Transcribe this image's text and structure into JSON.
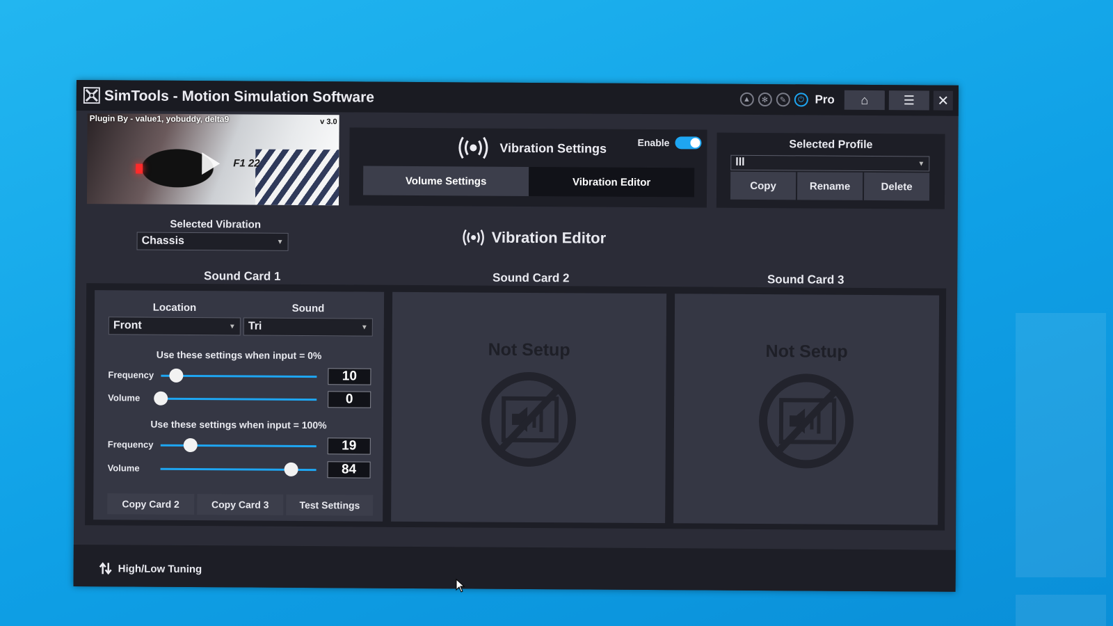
{
  "app": {
    "title": "SimTools - Motion Simulation Software"
  },
  "titlebar": {
    "pro_label": "Pro"
  },
  "banner": {
    "credit": "Plugin By - value1, yobuddy, delta9",
    "version": "v 3.0",
    "game": "F1 22"
  },
  "vibration_settings": {
    "title": "Vibration Settings",
    "enable_label": "Enable",
    "enabled": true,
    "tabs": [
      {
        "label": "Volume Settings",
        "active": true
      },
      {
        "label": "Vibration Editor",
        "active": false
      }
    ]
  },
  "profile": {
    "label": "Selected Profile",
    "value": "lll",
    "buttons": {
      "copy": "Copy",
      "rename": "Rename",
      "delete": "Delete"
    }
  },
  "selected_vibration": {
    "label": "Selected Vibration",
    "value": "Chassis"
  },
  "editor": {
    "title": "Vibration Editor"
  },
  "cards": {
    "c1": {
      "title": "Sound Card 1",
      "location_label": "Location",
      "location_value": "Front",
      "sound_label": "Sound",
      "sound_value": "Tri",
      "low_label": "Use these settings when input = 0%",
      "high_label": "Use these settings when input = 100%",
      "frequency_label": "Frequency",
      "volume_label": "Volume",
      "low_frequency": "10",
      "low_volume": "0",
      "high_frequency": "19",
      "high_volume": "84",
      "btn_copy2": "Copy Card 2",
      "btn_copy3": "Copy Card 3",
      "btn_test": "Test Settings"
    },
    "c2": {
      "title": "Sound Card 2",
      "status": "Not Setup"
    },
    "c3": {
      "title": "Sound Card 3",
      "status": "Not Setup"
    }
  },
  "footer": {
    "tuning_label": "High/Low Tuning"
  },
  "colors": {
    "accent": "#1ea6f2",
    "window_bg": "#2b2c37",
    "panel_bg": "#1d1e26",
    "button_bg": "#3c3e4b"
  }
}
